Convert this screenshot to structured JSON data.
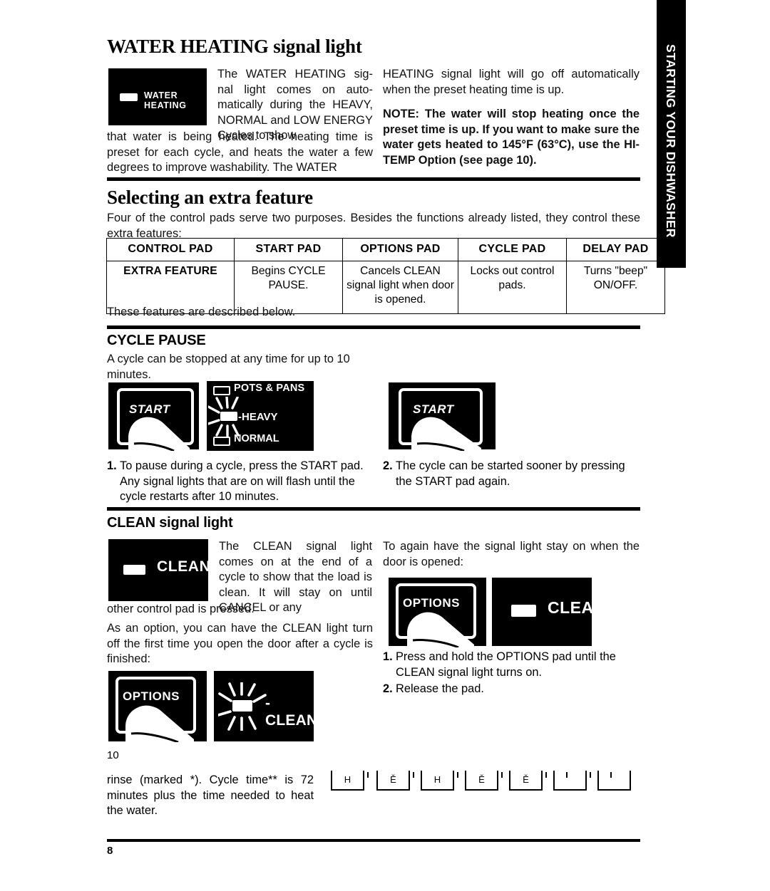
{
  "side_tab": {
    "label": "STARTING YOUR DISHWASHER"
  },
  "water_heating": {
    "title": "WATER HEATING signal light",
    "panel": {
      "label": "WATER HEATING",
      "lamp": "indicator-lamp"
    },
    "col1_top": "The WATER HEATING sig-nal light comes on auto-matically during the HEAVY, NORMAL and LOW ENERGY Cycles to show",
    "col1_bottom": "that water is being heated. The heating time is preset for each cycle, and heats the water a few degrees to improve washability. The WATER",
    "col2_top": "HEATING signal light will go off automatically when the preset heating time is up.",
    "col2_note": "NOTE: The water will stop heating once the preset time is up. If you want to make sure the water gets heated to 145°F (63°C), use the HI-TEMP Option (see page 10)."
  },
  "extra_feature": {
    "title": "Selecting an extra feature",
    "intro": "Four of the control pads serve two purposes. Besides the functions already listed, they control these extra features:",
    "table": {
      "headers": [
        "CONTROL PAD",
        "START PAD",
        "OPTIONS PAD",
        "CYCLE PAD",
        "DELAY PAD"
      ],
      "row": [
        "EXTRA FEATURE",
        "Begins CYCLE PAUSE.",
        "Cancels CLEAN signal light when door is opened.",
        "Locks out control pads.",
        "Turns \"beep\" ON/OFF."
      ]
    },
    "after": "These features are described below."
  },
  "cycle_pause": {
    "title": "CYCLE PAUSE",
    "intro": "A cycle can be stopped at any time for up to 10 minutes.",
    "fig_start_label": "START",
    "fig_pots_labels": [
      "POTS & PANS",
      "HEAVY",
      "NORMAL"
    ],
    "steps": [
      {
        "num": "1.",
        "text": "To pause during a cycle, press the START pad. Any signal lights that are on will flash until the cycle restarts after 10 minutes."
      },
      {
        "num": "2.",
        "text": "The cycle can be started sooner by pressing the START pad again."
      }
    ]
  },
  "clean_signal": {
    "title": "CLEAN signal light",
    "panel": {
      "label": "CLEAN",
      "lamp": "indicator-lamp"
    },
    "col1_top": "The CLEAN signal light comes on at the end of a cycle to show that the load is clean. It will stay on until CANCEL or any",
    "col1_mid": "other control pad is pressed.",
    "col1_bottom": "As an option, you can have the CLEAN light turn off the first time you open the door after a cycle is finished:",
    "col2_top": "To again have the signal light stay on when the door is opened:",
    "fig_options_label": "OPTIONS",
    "fig_clean_label": "CLEAN",
    "steps": [
      {
        "num": "1.",
        "text": "Press and hold the OPTIONS pad until the CLEAN signal light turns on."
      },
      {
        "num": "2.",
        "text": "Release the pad."
      }
    ]
  },
  "bottom": {
    "page_ref": "10",
    "tail_text": "rinse (marked *). Cycle time** is 72 minutes plus the time needed to heat the water.",
    "glyphs": [
      "H",
      "Ě",
      "H",
      "Ě",
      "Ě",
      "",
      ""
    ],
    "page_number": "8"
  }
}
